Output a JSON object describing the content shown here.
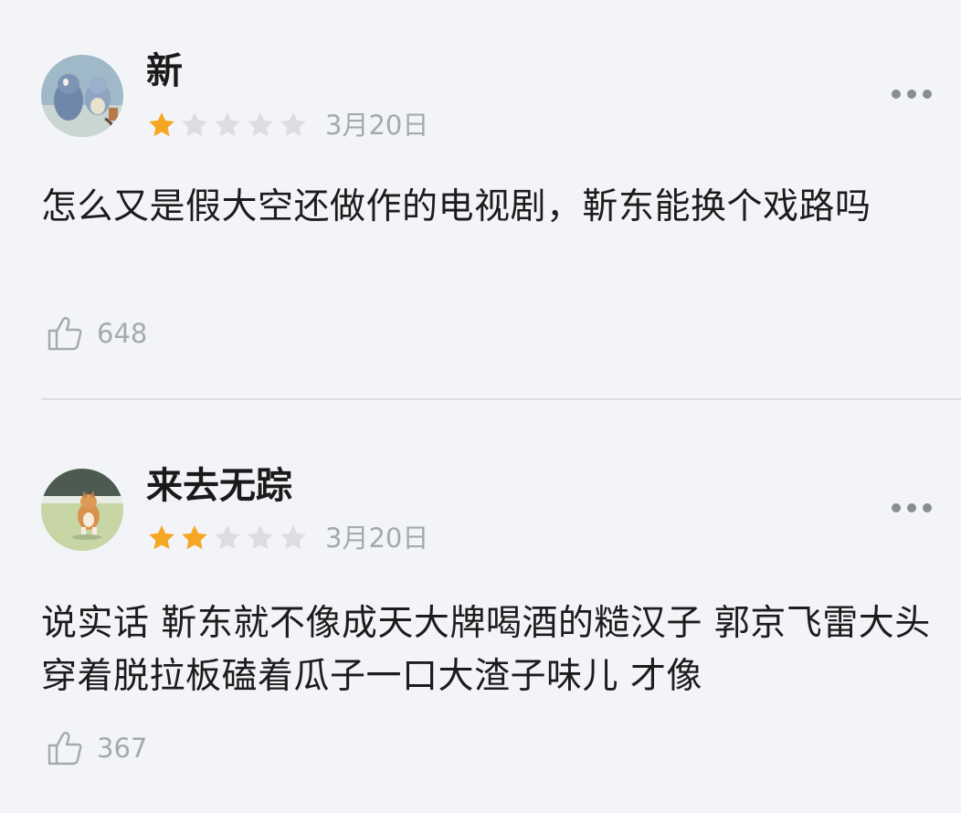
{
  "reviews": [
    {
      "username": "新",
      "rating": 1,
      "max_rating": 5,
      "date": "3月20日",
      "comment": "怎么又是假大空还做作的电视剧，靳东能换个戏路吗",
      "likes": "648",
      "avatar_icon": "cartoon-cat-mouse-avatar"
    },
    {
      "username": "来去无踪",
      "rating": 2,
      "max_rating": 5,
      "date": "3月20日",
      "comment": "说实话 靳东就不像成天大牌喝酒的糙汉子 郭京飞雷大头穿着脱拉板磕着瓜子一口大渣子味儿 才像",
      "likes": "367",
      "avatar_icon": "corgi-dog-avatar"
    }
  ],
  "colors": {
    "background": "#f3f4f8",
    "star_filled": "#f5a623",
    "star_empty": "#dcdde2",
    "meta_text": "#a6a8b0"
  },
  "icons": {
    "like": "thumbs-up-icon",
    "more": "more-dots-icon",
    "star": "star-icon"
  }
}
